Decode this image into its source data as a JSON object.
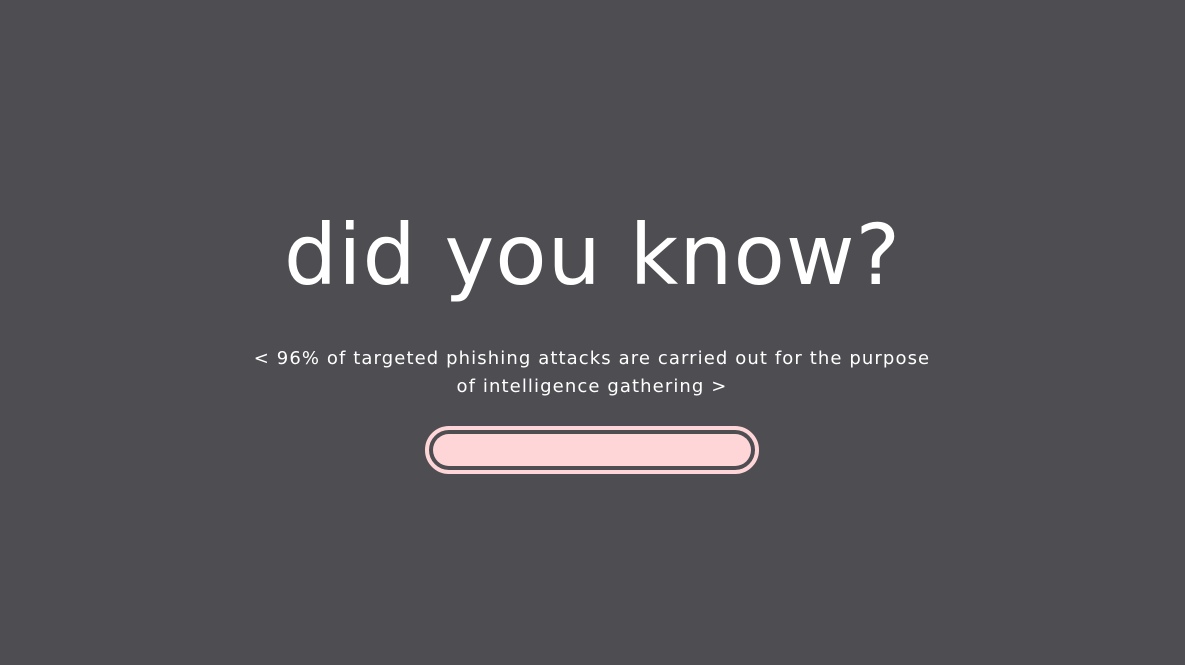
{
  "headline": "did you know?",
  "fact": "< 96% of targeted phishing attacks are carried out for the purpose of intelligence gathering >",
  "progress": {
    "fraction": 1.0
  },
  "colors": {
    "background": "#4e4d52",
    "text": "#ffffff",
    "accent": "#ffd6d8"
  }
}
